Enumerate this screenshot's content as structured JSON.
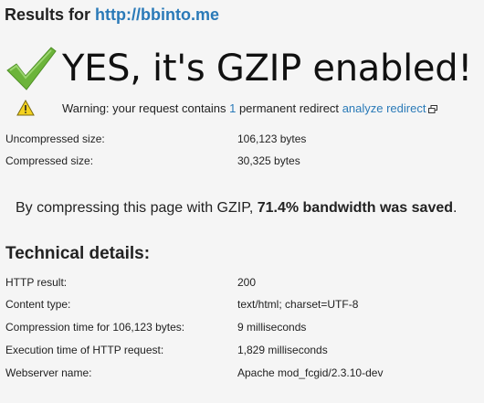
{
  "header": {
    "label": "Results for",
    "url": "http://bbinto.me"
  },
  "verdict": {
    "headline": "YES, it's GZIP enabled!",
    "icon": "checkmark-icon",
    "color": "#6cb43a"
  },
  "warning": {
    "icon": "warning-icon",
    "text_before": "Warning: your request contains",
    "count": "1",
    "text_after": "permanent redirect",
    "link_label": "analyze redirect",
    "link_icon": "external-window-icon"
  },
  "sizes": [
    {
      "label": "Uncompressed size:",
      "value": "106,123 bytes"
    },
    {
      "label": "Compressed size:",
      "value": "30,325 bytes"
    }
  ],
  "summary": {
    "text": "By compressing this page with GZIP,",
    "highlight": "71.4% bandwidth was saved",
    "end": "."
  },
  "technical": {
    "title": "Technical details:",
    "rows": [
      {
        "label": "HTTP result:",
        "value": "200"
      },
      {
        "label": "Content type:",
        "value": "text/html; charset=UTF-8"
      },
      {
        "label": "Compression time for 106,123 bytes:",
        "value": "9 milliseconds"
      },
      {
        "label": "Execution time of HTTP request:",
        "value": "1,829 milliseconds"
      },
      {
        "label": "Webserver name:",
        "value": "Apache mod_fcgid/2.3.10-dev"
      }
    ]
  },
  "colors": {
    "link": "#2a7ab8",
    "background": "#f5f5f5"
  }
}
